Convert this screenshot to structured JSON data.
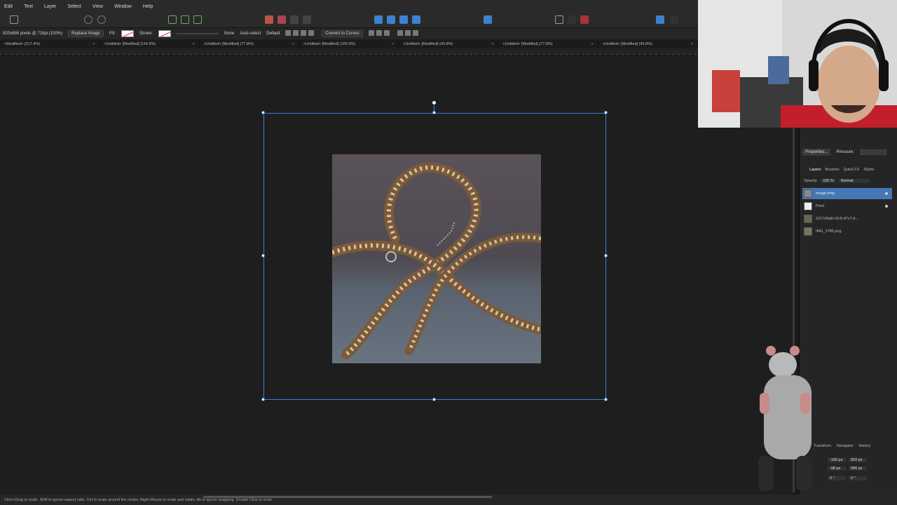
{
  "menu": [
    "Edit",
    "Text",
    "Layer",
    "Select",
    "View",
    "Window",
    "Help"
  ],
  "context": {
    "doc_info": "820x686 pixels @ 72dpi (100%)",
    "replace_image": "Replace Image",
    "fill_label": "Fill:",
    "stroke_label": "Stroke:",
    "none_label": "None",
    "auto_select": "Auto-select",
    "auto_select_value": "Default",
    "convert_to_curves": "Convert to Curves"
  },
  "tabs": [
    "<Modified> (217.4%)",
    "<Untitled> [Modified] (114.9%)",
    "<Untitled> [Modified] (77.8%)",
    "<Untitled> [Modified] (100.0%)",
    "<Untitled> [Modified] (43.8%)",
    "<Untitled> [Modified] (77.8%)",
    "<Untitled> [Modified] (43.8%)"
  ],
  "panel": {
    "properties": "Properties...",
    "pressure": "Pressure:",
    "tabs": [
      "Layers",
      "Brushes",
      "Quick FX",
      "Styles"
    ],
    "opacity_label": "Opacity:",
    "opacity_value": "100 %",
    "blend_mode": "Normal",
    "layers": [
      {
        "name": "image.bmp",
        "selected": true
      },
      {
        "name": "Pixel",
        "selected": false
      },
      {
        "name": "2217d3a8-c5c5-47c7-b...",
        "selected": false
      },
      {
        "name": "IMG_1785.png",
        "selected": false
      }
    ],
    "bottom_tabs": [
      "Transform",
      "Navigator",
      "History"
    ],
    "transform": {
      "x": "-165 px",
      "y": "-98 px",
      "w": "820 px",
      "h": "686 px",
      "r": "0 °",
      "s": "0 °"
    }
  },
  "status": "Click+Drag to scale. Shift to ignore aspect ratio. Ctrl to scale around the center. Right Mouse to scale and rotate. Alt to ignore snapping. Double-Click to reset."
}
